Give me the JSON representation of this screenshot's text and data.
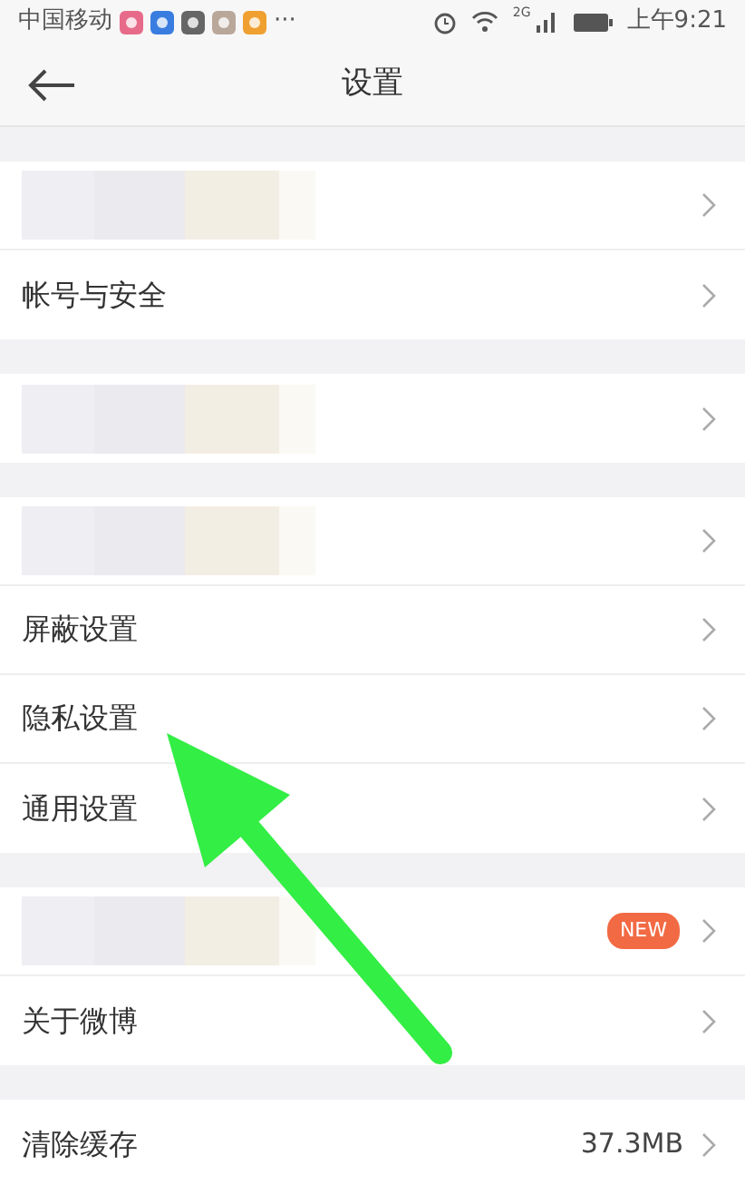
{
  "status_bar": {
    "carrier": "中国移动",
    "more": "···",
    "network": "2G",
    "time": "上午9:21"
  },
  "header": {
    "back": true,
    "title": "设置"
  },
  "groups": [
    {
      "rows": [
        {
          "kind": "redacted"
        },
        {
          "kind": "text",
          "label": "帐号与安全"
        }
      ]
    },
    {
      "rows": [
        {
          "kind": "redacted"
        }
      ]
    },
    {
      "rows": [
        {
          "kind": "redacted"
        },
        {
          "kind": "text",
          "label": "屏蔽设置"
        },
        {
          "kind": "text",
          "label": "隐私设置"
        },
        {
          "kind": "text",
          "label": "通用设置"
        }
      ]
    },
    {
      "rows": [
        {
          "kind": "redacted",
          "badge": "NEW"
        },
        {
          "kind": "text",
          "label": "关于微博"
        }
      ]
    },
    {
      "rows": [
        {
          "kind": "text",
          "label": "清除缓存",
          "value": "37.3MB"
        }
      ]
    }
  ],
  "annotations": [
    {
      "kind": "arrow"
    }
  ]
}
